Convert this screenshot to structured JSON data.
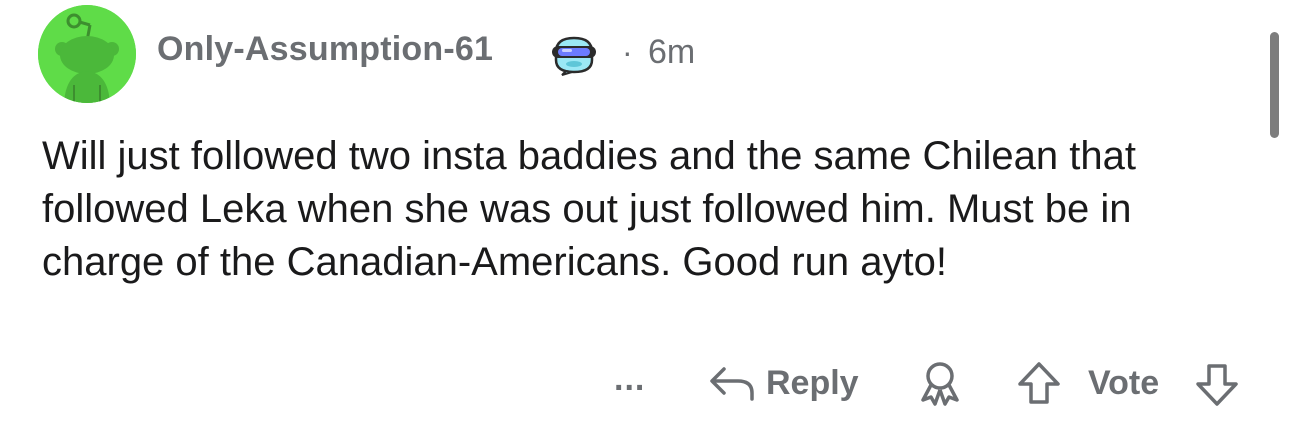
{
  "comment": {
    "author": "Only-Assumption-61",
    "separator": "·",
    "age": "6m",
    "avatar_color": "#5fdc48",
    "flair_icon": "goggles-snoo-icon",
    "body": "Will just followed two insta baddies and the same Chilean that followed Leka when she was out just followed him. Must be in charge of the Canadian-Americans. Good run ayto!"
  },
  "actions": {
    "more_label": "...",
    "reply_label": "Reply",
    "vote_label": "Vote",
    "icons": [
      "more-icon",
      "reply-arrow-icon",
      "award-icon",
      "upvote-arrow-icon",
      "downvote-arrow-icon"
    ]
  },
  "colors": {
    "meta_text": "#6b6e72",
    "body_text": "#1a1a1b"
  }
}
